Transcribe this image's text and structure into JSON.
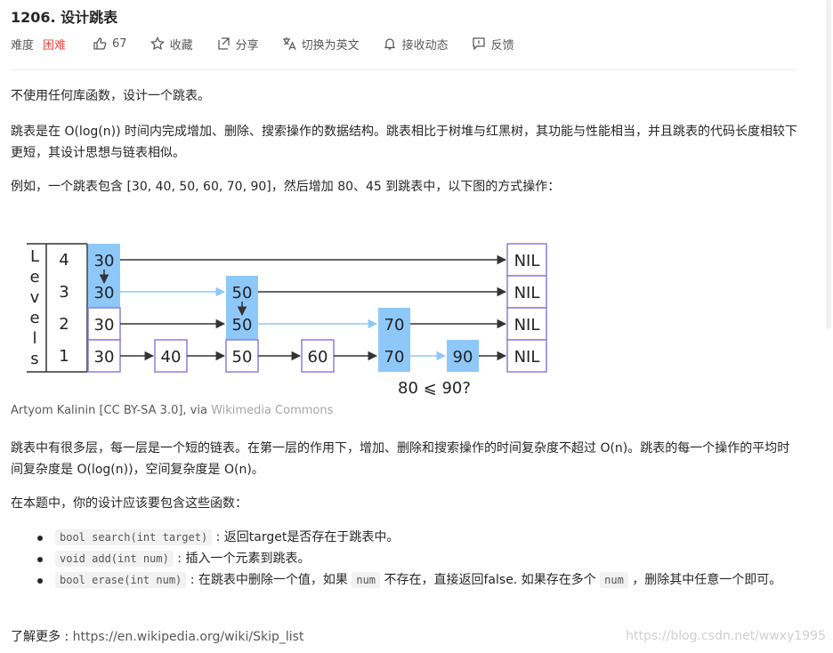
{
  "title": "1206. 设计跳表",
  "meta": {
    "difficulty_label": "难度",
    "difficulty": "困难",
    "likes": "67",
    "favorite": "收藏",
    "share": "分享",
    "translate": "切换为英文",
    "notify": "接收动态",
    "feedback": "反馈",
    "difficulty_color": "#ef4743"
  },
  "content": {
    "p1": "不使用任何库函数，设计一个跳表。",
    "p2": "跳表是在 O(log(n)) 时间内完成增加、删除、搜索操作的数据结构。跳表相比于树堆与红黑树，其功能与性能相当，并且跳表的代码长度相较下更短，其设计思想与链表相似。",
    "p3": "例如，一个跳表包含 [30, 40, 50, 60, 70, 90]，然后增加 80、45 到跳表中，以下图的方式操作：",
    "p4": "跳表中有很多层，每一层是一个短的链表。在第一层的作用下，增加、删除和搜索操作的时间复杂度不超过 O(n)。跳表的每一个操作的平均时间复杂度是 O(log(n))，空间复杂度是 O(n)。",
    "p5": "在本题中，你的设计应该要包含这些函数："
  },
  "figure": {
    "axis_letters": [
      "L",
      "e",
      "v",
      "e",
      "l",
      "s"
    ],
    "levels": [
      "4",
      "3",
      "2",
      "1"
    ],
    "nodes": {
      "n30_4": "30",
      "n30_3": "30",
      "n30_2": "30",
      "n30_1": "30",
      "n40": "40",
      "n50_3": "50",
      "n50_2": "50",
      "n50_1": "50",
      "n60": "60",
      "n70_2": "70",
      "n70_1": "70",
      "n90": "90",
      "nil": "NIL"
    },
    "search_label": "80 ⩽ 90?",
    "highlight_color": "#8ec8f8",
    "node_border": "#8a7fe0"
  },
  "credit": {
    "text": "Artyom Kalinin [CC BY-SA 3.0], via",
    "link": "Wikimedia Commons"
  },
  "functions": [
    {
      "code": "bool search(int target)",
      "desc": " : 返回target是否存在于跳表中。"
    },
    {
      "code": "void add(int num)",
      "desc": " : 插入一个元素到跳表。"
    },
    {
      "code": "bool erase(int num)",
      "desc_a": " : 在跳表中删除一个值，如果 ",
      "code2": "num",
      "desc_b": " 不存在，直接返回false. 如果存在多个 ",
      "code3": "num",
      "desc_c": " ，删除其中任意一个即可。"
    }
  ],
  "more": {
    "label": "了解更多 : ",
    "url": "https://en.wikipedia.org/wiki/Skip_list"
  },
  "watermark": "https://blog.csdn.net/wwxy1995"
}
